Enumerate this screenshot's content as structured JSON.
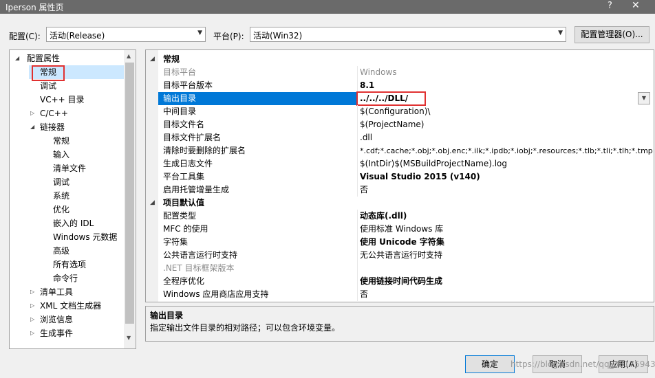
{
  "window": {
    "title": "Iperson 属性页",
    "help": "?",
    "close": "✕"
  },
  "config_bar": {
    "config_label": "配置(C):",
    "config_value": "活动(Release)",
    "platform_label": "平台(P):",
    "platform_value": "活动(Win32)",
    "manager_button": "配置管理器(O)..."
  },
  "tree": {
    "items": [
      {
        "label": "配置属性",
        "arrow": "◢"
      },
      {
        "label": "常规"
      },
      {
        "label": "调试"
      },
      {
        "label": "VC++ 目录"
      },
      {
        "label": "C/C++",
        "arrow": "▷"
      },
      {
        "label": "链接器",
        "arrow": "◢"
      },
      {
        "label": "常规"
      },
      {
        "label": "输入"
      },
      {
        "label": "清单文件"
      },
      {
        "label": "调试"
      },
      {
        "label": "系统"
      },
      {
        "label": "优化"
      },
      {
        "label": "嵌入的 IDL"
      },
      {
        "label": "Windows 元数据"
      },
      {
        "label": "高级"
      },
      {
        "label": "所有选项"
      },
      {
        "label": "命令行"
      },
      {
        "label": "清单工具",
        "arrow": "▷"
      },
      {
        "label": "XML 文档生成器",
        "arrow": "▷"
      },
      {
        "label": "浏览信息",
        "arrow": "▷"
      },
      {
        "label": "生成事件",
        "arrow": "▷"
      }
    ]
  },
  "grid": {
    "rows": [
      {
        "kind": "cat",
        "name": "常规"
      },
      {
        "name": "目标平台",
        "value": "Windows",
        "style": "dim"
      },
      {
        "name": "目标平台版本",
        "value": "8.1",
        "style": "bold"
      },
      {
        "name": "输出目录",
        "value": "../../../DLL/",
        "style": "sel"
      },
      {
        "name": "中间目录",
        "value": "$(Configuration)\\"
      },
      {
        "name": "目标文件名",
        "value": "$(ProjectName)"
      },
      {
        "name": "目标文件扩展名",
        "value": ".dll"
      },
      {
        "name": "清除时要删除的扩展名",
        "value": "*.cdf;*.cache;*.obj;*.obj.enc;*.ilk;*.ipdb;*.iobj;*.resources;*.tlb;*.tli;*.tlh;*.tmp"
      },
      {
        "name": "生成日志文件",
        "value": "$(IntDir)$(MSBuildProjectName).log"
      },
      {
        "name": "平台工具集",
        "value": "Visual Studio 2015 (v140)",
        "style": "bold"
      },
      {
        "name": "启用托管增量生成",
        "value": "否"
      },
      {
        "kind": "cat",
        "name": "项目默认值"
      },
      {
        "name": "配置类型",
        "value": "动态库(.dll)",
        "style": "bold"
      },
      {
        "name": "MFC 的使用",
        "value": "使用标准 Windows 库"
      },
      {
        "name": "字符集",
        "value": "使用 Unicode 字符集",
        "style": "bold"
      },
      {
        "name": "公共语言运行时支持",
        "value": "无公共语言运行时支持"
      },
      {
        "name": ".NET 目标框架版本",
        "value": "",
        "style": "dim"
      },
      {
        "name": "全程序优化",
        "value": "使用链接时间代码生成",
        "style": "bold"
      },
      {
        "name": "Windows 应用商店应用支持",
        "value": "否"
      }
    ]
  },
  "description": {
    "title": "输出目录",
    "text": "指定输出文件目录的相对路径；可以包含环境变量。"
  },
  "footer": {
    "ok": "确定",
    "cancel": "取消",
    "apply": "应用(A)",
    "watermark": "https://blog.csdn.net/qq_33175943"
  },
  "colors": {
    "selection": "#0078d7",
    "highlight_box": "#e03030"
  }
}
